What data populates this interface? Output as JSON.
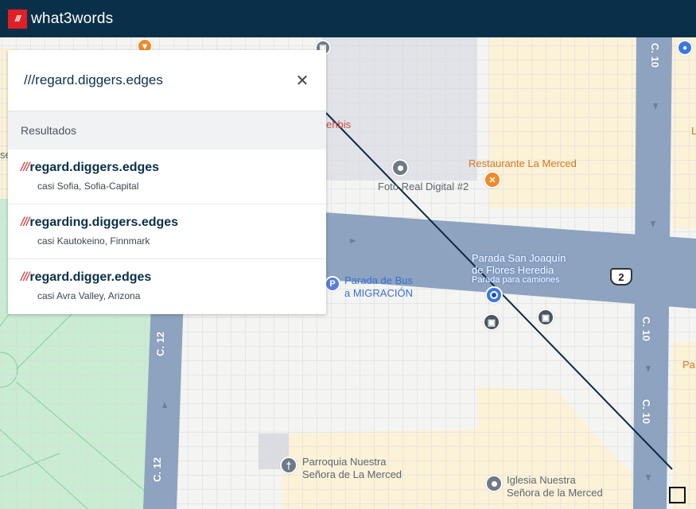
{
  "header": {
    "logo_mark": "///",
    "logo_text": "what3words"
  },
  "search": {
    "value": "///regard.diggers.edges",
    "close_icon": "close-icon"
  },
  "results": {
    "heading": "Resultados",
    "items": [
      {
        "prefix": "///",
        "words": "regard.diggers.edges",
        "place": "casi Sofia, Sofia-Capital"
      },
      {
        "prefix": "///",
        "words": "regarding.diggers.edges",
        "place": "casi Kautokeino, Finnmark"
      },
      {
        "prefix": "///",
        "words": "regard.digger.edges",
        "place": "casi Avra Valley, Arizona"
      }
    ]
  },
  "map": {
    "pois": {
      "restaurante": "Restaurante La Merced",
      "foto": "Foto Real Digital #2",
      "parada_bus_1": "Parada de Bus",
      "parada_bus_2": "a MIGRACIÓN",
      "parada_sj_1": "Parada San Joaquín",
      "parada_sj_2": "de Flores Heredia",
      "parada_sj_3": "Parada para camiones",
      "parroquia_1": "Parroquia Nuestra",
      "parroquia_2": "Señora de La Merced",
      "iglesia_1": "Iglesia Nuestra",
      "iglesia_2": "Señora de la Merced",
      "partial_red": "ehbis",
      "partial_right_top": "L",
      "partial_right_bottom": "Pa",
      "partial_left": "se"
    },
    "streets": {
      "c12_upper": "C. 12",
      "c12_lower": "C. 12",
      "c10_top": "C. 10",
      "c10_mid": "C. 10",
      "c10_low": "C. 10"
    },
    "route_shield": "2",
    "pin_parking": "P",
    "colors": {
      "road": "#8da3bf",
      "park": "#c9ecd2",
      "building": "#fdf4dc",
      "block": "#e3e4ea",
      "header": "#0a3049",
      "accent": "#e11f26"
    }
  }
}
